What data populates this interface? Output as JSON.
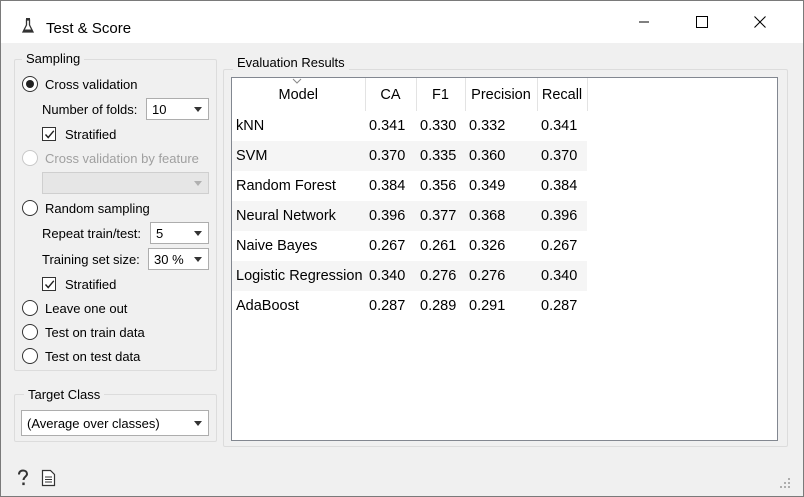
{
  "window": {
    "title": "Test & Score"
  },
  "icons": {
    "app": "flask-icon",
    "minimize": "minimize-icon",
    "maximize": "maximize-icon",
    "close": "close-icon",
    "help": "help-icon",
    "report": "report-icon"
  },
  "sampling": {
    "title": "Sampling",
    "cross_validation": "Cross validation",
    "folds_label": "Number of folds:",
    "folds_value": "10",
    "stratified_1": "Stratified",
    "cv_by_feature": "Cross validation by feature",
    "random_sampling": "Random sampling",
    "repeat_label": "Repeat train/test:",
    "repeat_value": "5",
    "train_size_label": "Training set size:",
    "train_size_value": "30 %",
    "stratified_2": "Stratified",
    "leave_one_out": "Leave one out",
    "test_on_train": "Test on train data",
    "test_on_test": "Test on test data"
  },
  "target_class": {
    "title": "Target Class",
    "value": "(Average over classes)"
  },
  "results": {
    "title": "Evaluation Results",
    "columns": [
      "Model",
      "CA",
      "F1",
      "Precision",
      "Recall"
    ],
    "rows": [
      [
        "kNN",
        "0.341",
        "0.330",
        "0.332",
        "0.341"
      ],
      [
        "SVM",
        "0.370",
        "0.335",
        "0.360",
        "0.370"
      ],
      [
        "Random Forest",
        "0.384",
        "0.356",
        "0.349",
        "0.384"
      ],
      [
        "Neural Network",
        "0.396",
        "0.377",
        "0.368",
        "0.396"
      ],
      [
        "Naive Bayes",
        "0.267",
        "0.261",
        "0.326",
        "0.267"
      ],
      [
        "Logistic Regression",
        "0.340",
        "0.276",
        "0.276",
        "0.340"
      ],
      [
        "AdaBoost",
        "0.287",
        "0.289",
        "0.291",
        "0.287"
      ]
    ]
  }
}
